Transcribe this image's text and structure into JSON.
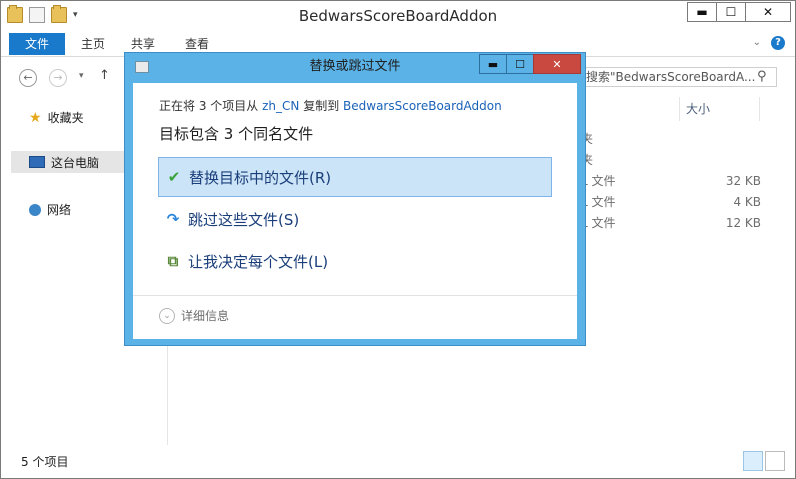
{
  "window": {
    "title": "BedwarsScoreBoardAddon",
    "min": "▬",
    "max": "☐",
    "close": "✕"
  },
  "ribbon": {
    "tabs": [
      "文件",
      "主页",
      "共享",
      "查看"
    ]
  },
  "search": {
    "placeholder": "搜索\"BedwarsScoreBoardA..."
  },
  "sidebar": {
    "items": [
      "收藏夹",
      "这台电脑",
      "网络"
    ]
  },
  "content": {
    "col_size": "大小",
    "rows": [
      {
        "partial": "夹",
        "size": ""
      },
      {
        "partial": "夹",
        "size": ""
      },
      {
        "partial": "L 文件",
        "size": "32 KB"
      },
      {
        "partial": "L 文件",
        "size": "4 KB"
      },
      {
        "partial": "L 文件",
        "size": "12 KB"
      }
    ]
  },
  "status": {
    "count": "5 个项目"
  },
  "dialog": {
    "title": "替换或跳过文件",
    "copy_prefix": "正在将 3 个项目从",
    "source": "zh_CN",
    "copy_mid": "复制到",
    "dest": "BedwarsScoreBoardAddon",
    "heading": "目标包含 3 个同名文件",
    "options": [
      "替换目标中的文件(R)",
      "跳过这些文件(S)",
      "让我决定每个文件(L)"
    ],
    "details": "详细信息"
  },
  "colors": {
    "accent": "#1979ca",
    "dialog_frame": "#5bb2e6",
    "close": "#c9483f",
    "selected": "#cce4f7"
  }
}
